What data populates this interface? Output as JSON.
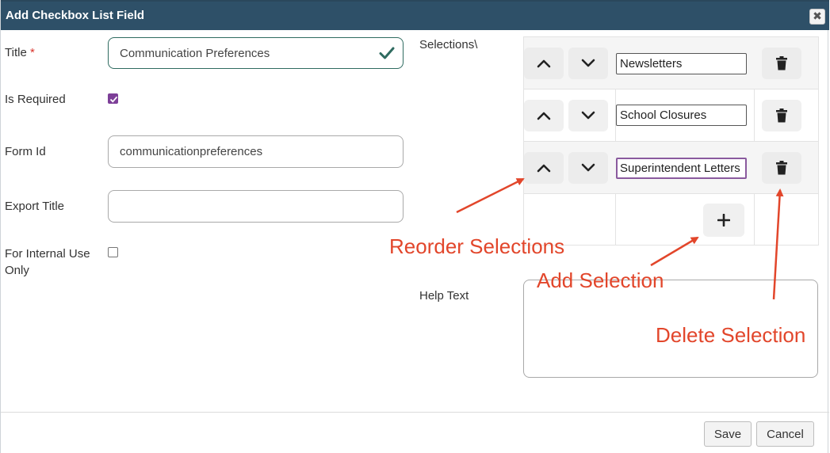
{
  "dialog": {
    "title": "Add Checkbox List Field",
    "close_symbol": "✖"
  },
  "form": {
    "title_label": "Title",
    "required_marker": "*",
    "title_value": "Communication Preferences",
    "is_required_label": "Is Required",
    "is_required_checked": true,
    "form_id_label": "Form Id",
    "form_id_value": "communicationpreferences",
    "export_title_label": "Export Title",
    "export_title_value": "",
    "internal_use_label_line1": "For Internal Use",
    "internal_use_label_line2": "Only",
    "internal_use_checked": false
  },
  "selections": {
    "label": "Selections\\",
    "items": [
      {
        "value": "Newsletters"
      },
      {
        "value": "School Closures"
      },
      {
        "value": "Superintendent Letters"
      }
    ],
    "icons": {
      "move_up": "chevron-up-icon",
      "move_down": "chevron-down-icon",
      "delete": "trash-icon",
      "add": "plus-icon"
    }
  },
  "help_text": {
    "label": "Help Text",
    "value": ""
  },
  "footer": {
    "save_label": "Save",
    "cancel_label": "Cancel"
  },
  "annotations": {
    "reorder": "Reorder Selections",
    "add": "Add Selection",
    "delete": "Delete Selection",
    "color": "#e2462b"
  },
  "colors": {
    "titlebar": "#2e5068",
    "checkbox_accent": "#7d3f98",
    "valid_check": "#2f6b60",
    "required_star": "#d9342b"
  }
}
